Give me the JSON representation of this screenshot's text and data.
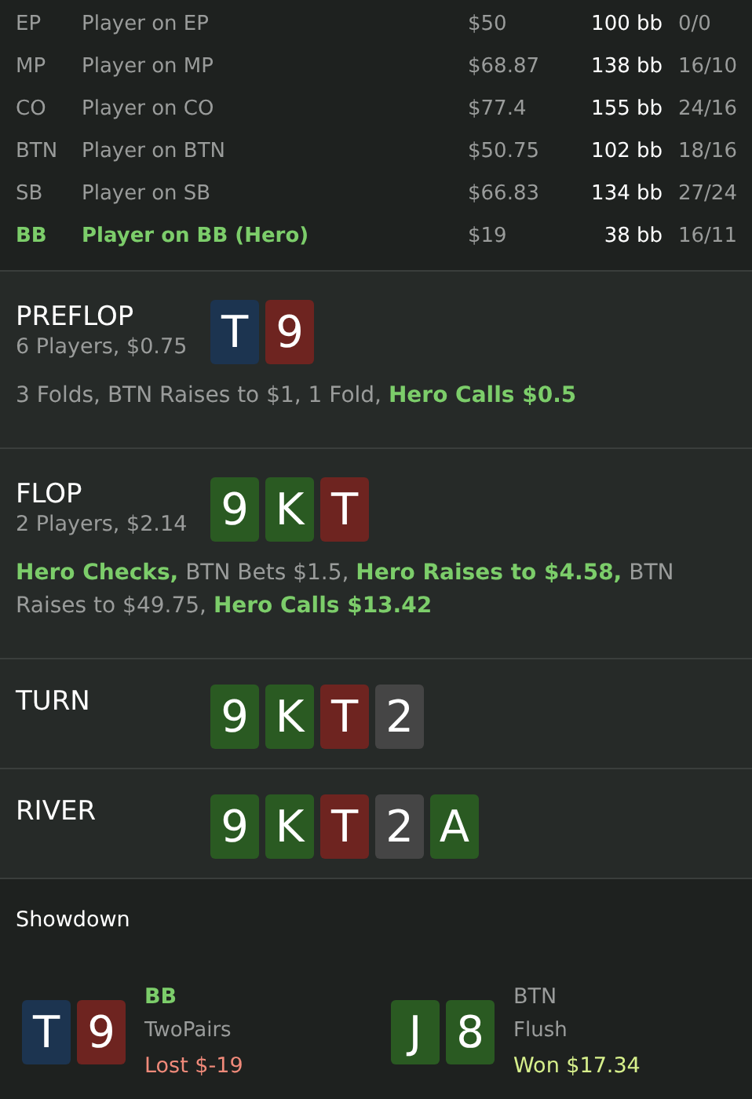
{
  "players": [
    {
      "position": "EP",
      "name": "Player on EP",
      "stack": "$50",
      "bb": "100 bb",
      "stats": "0/0",
      "hero": false
    },
    {
      "position": "MP",
      "name": "Player on MP",
      "stack": "$68.87",
      "bb": "138 bb",
      "stats": "16/10",
      "hero": false
    },
    {
      "position": "CO",
      "name": "Player on CO",
      "stack": "$77.4",
      "bb": "155 bb",
      "stats": "24/16",
      "hero": false
    },
    {
      "position": "BTN",
      "name": "Player on BTN",
      "stack": "$50.75",
      "bb": "102 bb",
      "stats": "18/16",
      "hero": false
    },
    {
      "position": "SB",
      "name": "Player on SB",
      "stack": "$66.83",
      "bb": "134 bb",
      "stats": "27/24",
      "hero": false
    },
    {
      "position": "BB",
      "name": "Player on BB (Hero)",
      "stack": "$19",
      "bb": "38 bb",
      "stats": "16/11",
      "hero": true
    }
  ],
  "streets": [
    {
      "name": "PREFLOP",
      "summary": "6 Players, $0.75",
      "cards": [
        {
          "rank": "T",
          "color": "#1c3450"
        },
        {
          "rank": "9",
          "color": "#6e2420"
        }
      ],
      "actions": [
        {
          "text": "3 Folds, BTN Raises to $1, 1 Fold,",
          "hero": false
        },
        {
          "text": "Hero Calls $0.5",
          "hero": true
        }
      ]
    },
    {
      "name": "FLOP",
      "summary": "2 Players, $2.14",
      "cards": [
        {
          "rank": "9",
          "color": "#2a5a22"
        },
        {
          "rank": "K",
          "color": "#2a5a22"
        },
        {
          "rank": "T",
          "color": "#6e2420"
        }
      ],
      "actions": [
        {
          "text": "Hero Checks,",
          "hero": true
        },
        {
          "text": "BTN Bets $1.5,",
          "hero": false
        },
        {
          "text": "Hero Raises to $4.58,",
          "hero": true
        },
        {
          "text": "BTN Raises to $49.75,",
          "hero": false
        },
        {
          "text": "Hero Calls $13.42",
          "hero": true
        }
      ]
    },
    {
      "name": "TURN",
      "cards": [
        {
          "rank": "9",
          "color": "#2a5a22"
        },
        {
          "rank": "K",
          "color": "#2a5a22"
        },
        {
          "rank": "T",
          "color": "#6e2420"
        },
        {
          "rank": "2",
          "color": "#454545"
        }
      ]
    },
    {
      "name": "RIVER",
      "cards": [
        {
          "rank": "9",
          "color": "#2a5a22"
        },
        {
          "rank": "K",
          "color": "#2a5a22"
        },
        {
          "rank": "T",
          "color": "#6e2420"
        },
        {
          "rank": "2",
          "color": "#454545"
        },
        {
          "rank": "A",
          "color": "#2a5a22"
        }
      ]
    }
  ],
  "showdown": {
    "title": "Showdown",
    "hands": [
      {
        "position": "BB",
        "hero": true,
        "hand": "TwoPairs",
        "result": "Lost $-19",
        "won": false,
        "cards": [
          {
            "rank": "T",
            "color": "#1c3450"
          },
          {
            "rank": "9",
            "color": "#6e2420"
          }
        ]
      },
      {
        "position": "BTN",
        "hero": false,
        "hand": "Flush",
        "result": "Won $17.34",
        "won": true,
        "cards": [
          {
            "rank": "J",
            "color": "#2a5a22"
          },
          {
            "rank": "8",
            "color": "#2a5a22"
          }
        ]
      }
    ]
  }
}
